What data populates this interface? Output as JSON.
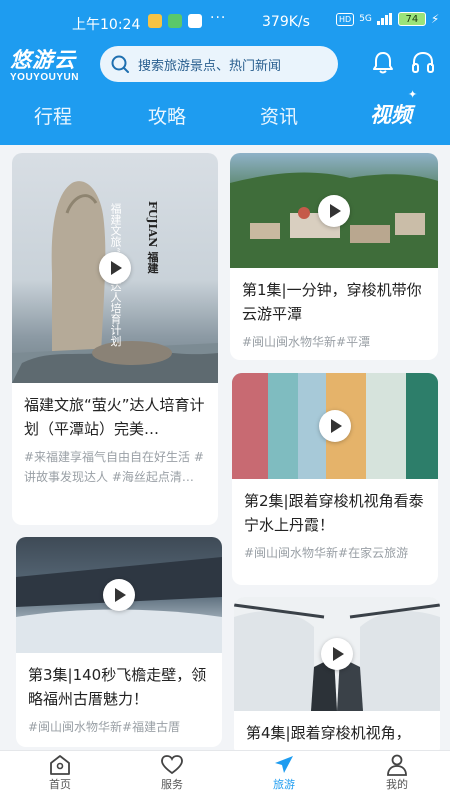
{
  "status_bar": {
    "time": "上午10:24",
    "dots": "···",
    "speed": "379K/s",
    "hd": "HD",
    "network": "5G",
    "battery": "74"
  },
  "app": {
    "logo_main": "悠游云",
    "logo_sub": "YOUYOUYUN"
  },
  "search": {
    "placeholder": "搜索旅游景点、热门新闻"
  },
  "tabs": [
    {
      "label": "行程"
    },
    {
      "label": "攻略"
    },
    {
      "label": "资讯"
    },
    {
      "label": "视频",
      "active": true
    }
  ],
  "cards": [
    {
      "title": "福建文旅“萤火”达人培育计划（平潭站）完美…",
      "tags": "#来福建享福气自由自在好生活 #讲故事发现达人 #海丝起点清…",
      "overlay_text": "FUJIAN 福建文旅“萤火”达人培育计划"
    },
    {
      "title": "第1集|一分钟，穿梭机带你云游平潭",
      "tags": "#闽山闽水物华新#平潭"
    },
    {
      "title": "第2集|跟着穿梭机视角看泰宁水上丹霞！",
      "tags": "#闽山闽水物华新#在家云旅游"
    },
    {
      "title": "第3集|140秒飞檐走壁，领略福州古厝魅力！",
      "tags": "#闽山闽水物华新#福建古厝"
    },
    {
      "title": "第4集|跟着穿梭机视角，",
      "tags": ""
    }
  ],
  "bottom_nav": [
    {
      "label": "首页",
      "icon": "home-icon"
    },
    {
      "label": "服务",
      "icon": "heart-hands-icon"
    },
    {
      "label": "旅游",
      "icon": "airplane-icon",
      "active": true
    },
    {
      "label": "我的",
      "icon": "user-icon"
    }
  ],
  "colors": {
    "brand_blue": "#1e9cf0",
    "background": "#f2f4f7"
  }
}
